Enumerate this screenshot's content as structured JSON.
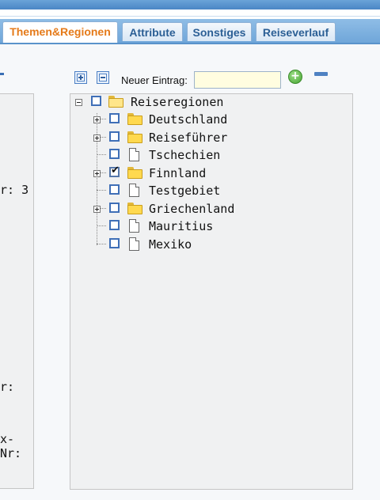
{
  "tabs": [
    {
      "label": "Themen&Regionen",
      "active": true
    },
    {
      "label": "Attribute",
      "active": false
    },
    {
      "label": "Sonstiges",
      "active": false
    },
    {
      "label": "Reiseverlauf",
      "active": false
    }
  ],
  "left_panel": {
    "labels": [
      "r: 3",
      "r:",
      "x-Nr:"
    ]
  },
  "toolbar": {
    "new_entry_label": "Neuer Eintrag:",
    "new_entry_value": "",
    "add_symbol": "+"
  },
  "tree": {
    "root": {
      "label": "Reiseregionen",
      "checked": false,
      "expanded": true
    },
    "items": [
      {
        "label": "Deutschland",
        "type": "folder",
        "checked": false
      },
      {
        "label": "Reiseführer",
        "type": "folder",
        "checked": false
      },
      {
        "label": "Tschechien",
        "type": "document",
        "checked": false
      },
      {
        "label": "Finnland",
        "type": "folder",
        "checked": true
      },
      {
        "label": "Testgebiet",
        "type": "document",
        "checked": false
      },
      {
        "label": "Griechenland",
        "type": "folder",
        "checked": false
      },
      {
        "label": "Mauritius",
        "type": "document",
        "checked": false
      },
      {
        "label": "Mexiko",
        "type": "document",
        "checked": false
      }
    ]
  },
  "colors": {
    "active_tab_text": "#e57a19",
    "tab_text": "#2b5f95",
    "input_background": "#fffde0"
  }
}
